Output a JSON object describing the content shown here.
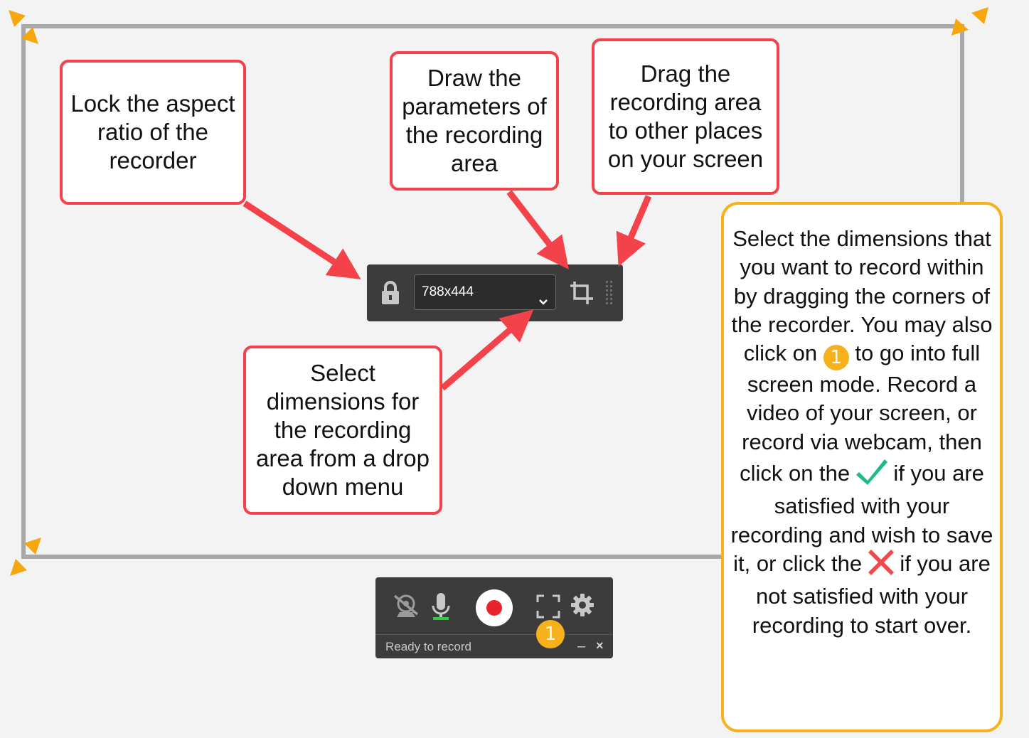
{
  "callouts": {
    "lock": "Lock the aspect ratio of the recorder",
    "draw": "Draw the parameters of the recording area",
    "drag": "Drag the recording area to other places on your screen",
    "select": "Select dimensions for the recording area from a drop down menu"
  },
  "info_box": {
    "part1": "Select the dimensions that you want to record within by dragging the corners of the recorder. You may also click on",
    "badge": "1",
    "part2": "to go into full screen mode. Record a video of your screen, or record via webcam, then click on the",
    "part3": "if you are satisfied with your recording and wish to save it, or click the",
    "part4": "if you are not satisfied with your recording to start over."
  },
  "toolbar_top": {
    "dimensions_value": "788x444"
  },
  "toolbar_bottom": {
    "status": "Ready to record",
    "fullscreen_badge": "1",
    "minimize": "–",
    "close": "×"
  },
  "colors": {
    "callout_border": "#f4424b",
    "info_border": "#f6b11c",
    "arrow": "#f4424b",
    "corner_handle": "#f6a70e",
    "toolbar_bg": "#3c3c3c",
    "record_red": "#e8232b",
    "mic_green": "#2ecc40",
    "check_green": "#1fb98a"
  },
  "icons": [
    "lock-icon",
    "chevron-down-icon",
    "crop-icon",
    "drag-handle-icon",
    "webcam-off-icon",
    "microphone-icon",
    "record-icon",
    "fullscreen-icon",
    "gear-icon",
    "checkmark-icon",
    "x-mark-icon"
  ]
}
